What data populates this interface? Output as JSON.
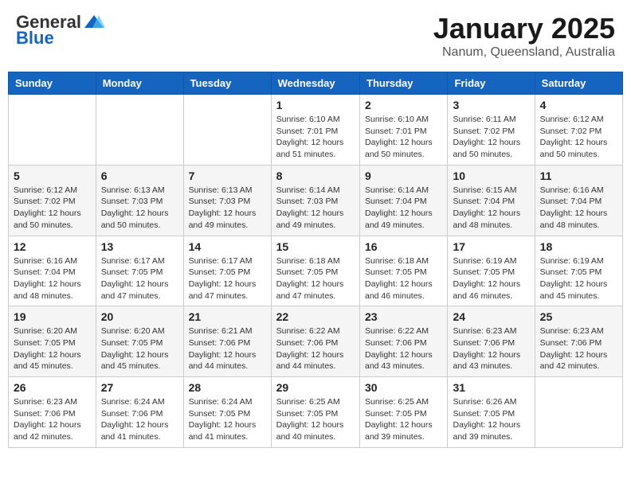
{
  "header": {
    "logo_general": "General",
    "logo_blue": "Blue",
    "month_title": "January 2025",
    "location": "Nanum, Queensland, Australia"
  },
  "days_of_week": [
    "Sunday",
    "Monday",
    "Tuesday",
    "Wednesday",
    "Thursday",
    "Friday",
    "Saturday"
  ],
  "weeks": [
    [
      {
        "day": "",
        "info": ""
      },
      {
        "day": "",
        "info": ""
      },
      {
        "day": "",
        "info": ""
      },
      {
        "day": "1",
        "info": "Sunrise: 6:10 AM\nSunset: 7:01 PM\nDaylight: 12 hours\nand 51 minutes."
      },
      {
        "day": "2",
        "info": "Sunrise: 6:10 AM\nSunset: 7:01 PM\nDaylight: 12 hours\nand 50 minutes."
      },
      {
        "day": "3",
        "info": "Sunrise: 6:11 AM\nSunset: 7:02 PM\nDaylight: 12 hours\nand 50 minutes."
      },
      {
        "day": "4",
        "info": "Sunrise: 6:12 AM\nSunset: 7:02 PM\nDaylight: 12 hours\nand 50 minutes."
      }
    ],
    [
      {
        "day": "5",
        "info": "Sunrise: 6:12 AM\nSunset: 7:02 PM\nDaylight: 12 hours\nand 50 minutes."
      },
      {
        "day": "6",
        "info": "Sunrise: 6:13 AM\nSunset: 7:03 PM\nDaylight: 12 hours\nand 50 minutes."
      },
      {
        "day": "7",
        "info": "Sunrise: 6:13 AM\nSunset: 7:03 PM\nDaylight: 12 hours\nand 49 minutes."
      },
      {
        "day": "8",
        "info": "Sunrise: 6:14 AM\nSunset: 7:03 PM\nDaylight: 12 hours\nand 49 minutes."
      },
      {
        "day": "9",
        "info": "Sunrise: 6:14 AM\nSunset: 7:04 PM\nDaylight: 12 hours\nand 49 minutes."
      },
      {
        "day": "10",
        "info": "Sunrise: 6:15 AM\nSunset: 7:04 PM\nDaylight: 12 hours\nand 48 minutes."
      },
      {
        "day": "11",
        "info": "Sunrise: 6:16 AM\nSunset: 7:04 PM\nDaylight: 12 hours\nand 48 minutes."
      }
    ],
    [
      {
        "day": "12",
        "info": "Sunrise: 6:16 AM\nSunset: 7:04 PM\nDaylight: 12 hours\nand 48 minutes."
      },
      {
        "day": "13",
        "info": "Sunrise: 6:17 AM\nSunset: 7:05 PM\nDaylight: 12 hours\nand 47 minutes."
      },
      {
        "day": "14",
        "info": "Sunrise: 6:17 AM\nSunset: 7:05 PM\nDaylight: 12 hours\nand 47 minutes."
      },
      {
        "day": "15",
        "info": "Sunrise: 6:18 AM\nSunset: 7:05 PM\nDaylight: 12 hours\nand 47 minutes."
      },
      {
        "day": "16",
        "info": "Sunrise: 6:18 AM\nSunset: 7:05 PM\nDaylight: 12 hours\nand 46 minutes."
      },
      {
        "day": "17",
        "info": "Sunrise: 6:19 AM\nSunset: 7:05 PM\nDaylight: 12 hours\nand 46 minutes."
      },
      {
        "day": "18",
        "info": "Sunrise: 6:19 AM\nSunset: 7:05 PM\nDaylight: 12 hours\nand 45 minutes."
      }
    ],
    [
      {
        "day": "19",
        "info": "Sunrise: 6:20 AM\nSunset: 7:05 PM\nDaylight: 12 hours\nand 45 minutes."
      },
      {
        "day": "20",
        "info": "Sunrise: 6:20 AM\nSunset: 7:05 PM\nDaylight: 12 hours\nand 45 minutes."
      },
      {
        "day": "21",
        "info": "Sunrise: 6:21 AM\nSunset: 7:06 PM\nDaylight: 12 hours\nand 44 minutes."
      },
      {
        "day": "22",
        "info": "Sunrise: 6:22 AM\nSunset: 7:06 PM\nDaylight: 12 hours\nand 44 minutes."
      },
      {
        "day": "23",
        "info": "Sunrise: 6:22 AM\nSunset: 7:06 PM\nDaylight: 12 hours\nand 43 minutes."
      },
      {
        "day": "24",
        "info": "Sunrise: 6:23 AM\nSunset: 7:06 PM\nDaylight: 12 hours\nand 43 minutes."
      },
      {
        "day": "25",
        "info": "Sunrise: 6:23 AM\nSunset: 7:06 PM\nDaylight: 12 hours\nand 42 minutes."
      }
    ],
    [
      {
        "day": "26",
        "info": "Sunrise: 6:23 AM\nSunset: 7:06 PM\nDaylight: 12 hours\nand 42 minutes."
      },
      {
        "day": "27",
        "info": "Sunrise: 6:24 AM\nSunset: 7:06 PM\nDaylight: 12 hours\nand 41 minutes."
      },
      {
        "day": "28",
        "info": "Sunrise: 6:24 AM\nSunset: 7:05 PM\nDaylight: 12 hours\nand 41 minutes."
      },
      {
        "day": "29",
        "info": "Sunrise: 6:25 AM\nSunset: 7:05 PM\nDaylight: 12 hours\nand 40 minutes."
      },
      {
        "day": "30",
        "info": "Sunrise: 6:25 AM\nSunset: 7:05 PM\nDaylight: 12 hours\nand 39 minutes."
      },
      {
        "day": "31",
        "info": "Sunrise: 6:26 AM\nSunset: 7:05 PM\nDaylight: 12 hours\nand 39 minutes."
      },
      {
        "day": "",
        "info": ""
      }
    ]
  ]
}
